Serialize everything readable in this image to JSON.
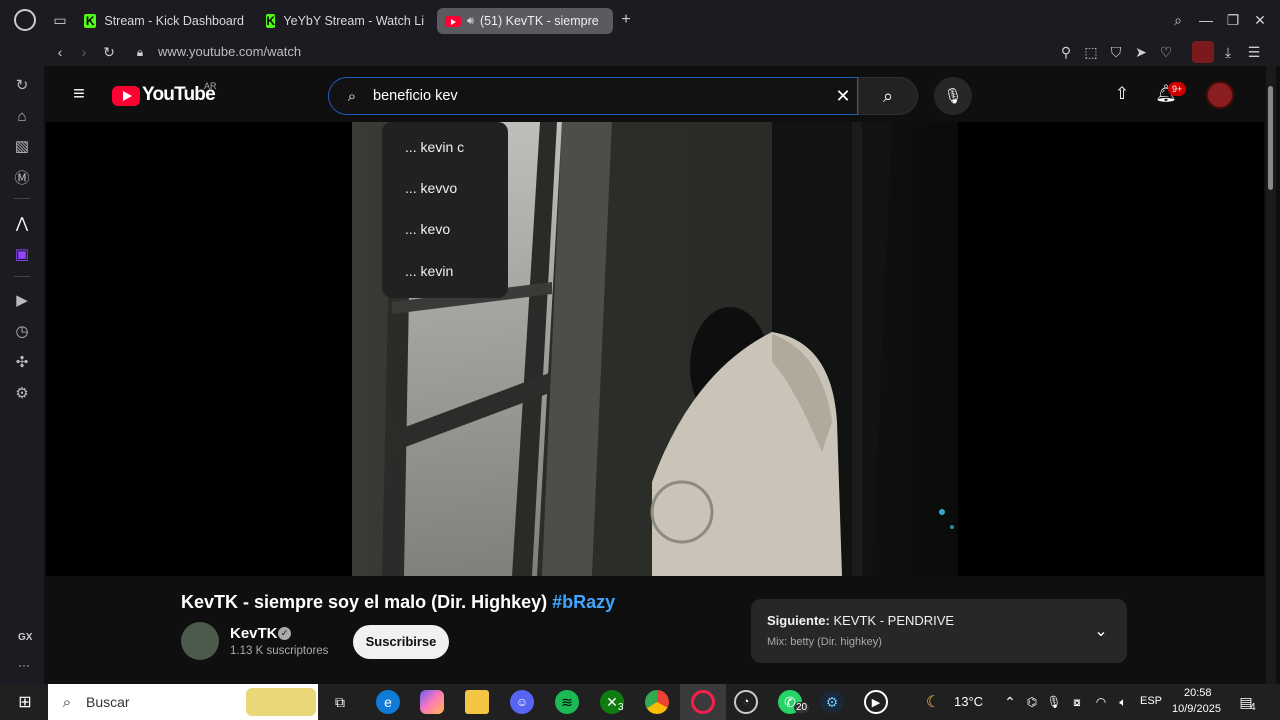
{
  "browser": {
    "tabs": [
      {
        "label": "Stream - Kick Dashboard"
      },
      {
        "label": "YeYbY Stream - Watch Li"
      },
      {
        "label": "(51) KevTK - siempre"
      }
    ],
    "new_tab_label": "+",
    "address": "www.youtube.com/watch"
  },
  "sidebar": {
    "bottom_label": "GX",
    "more_label": "···"
  },
  "youtube": {
    "logo_text": "YouTube",
    "region": "AR",
    "search_value": "beneficio kev",
    "suggestions": [
      "... kevin c",
      "... kevvo",
      "... kevo",
      "... kevin"
    ],
    "notification_badge": "9+"
  },
  "video": {
    "title_main": "KevTK - siempre soy el malo (Dir. Highkey)",
    "title_hashtag": "#bRazy",
    "channel_name": "KevTK",
    "subscribers": "1.13 K suscriptores",
    "subscribe_label": "Suscribirse"
  },
  "next": {
    "label_prefix": "Siguiente:",
    "label_title": "KEVTK - PENDRIVE",
    "mix": "Mix: betty (Dir. highkey)"
  },
  "taskbar": {
    "search_placeholder": "Buscar",
    "weather": "13°C",
    "lang": "ESP",
    "time": "20:58",
    "date": "10/9/2025",
    "badges": {
      "xbox": "3",
      "whatsapp": "20",
      "notifications": "4"
    }
  },
  "colors": {
    "accent_blue": "#3ea6ff",
    "youtube_red": "#ff0033",
    "kick_green": "#53fc18"
  }
}
